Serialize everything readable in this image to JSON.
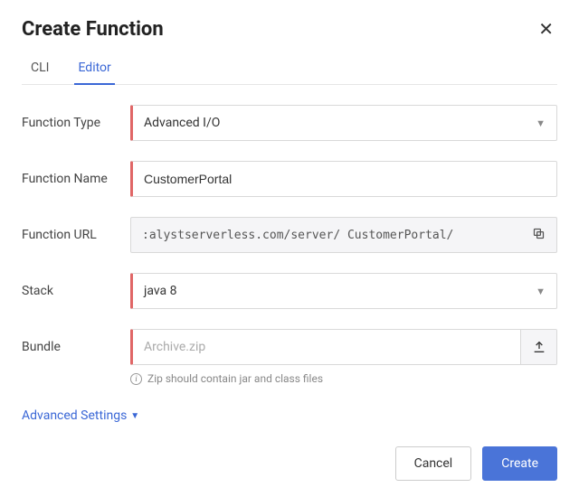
{
  "header": {
    "title": "Create Function"
  },
  "tabs": {
    "cli": "CLI",
    "editor": "Editor",
    "active": "editor"
  },
  "form": {
    "function_type": {
      "label": "Function Type",
      "value": "Advanced I/O"
    },
    "function_name": {
      "label": "Function Name",
      "value": "CustomerPortal"
    },
    "function_url": {
      "label": "Function URL",
      "value": ":alystserverless.com/server/ CustomerPortal/"
    },
    "stack": {
      "label": "Stack",
      "value": "java 8"
    },
    "bundle": {
      "label": "Bundle",
      "placeholder": "Archive.zip",
      "hint": "Zip should contain jar and class files"
    }
  },
  "advanced": {
    "label": "Advanced Settings"
  },
  "footer": {
    "cancel": "Cancel",
    "create": "Create"
  }
}
